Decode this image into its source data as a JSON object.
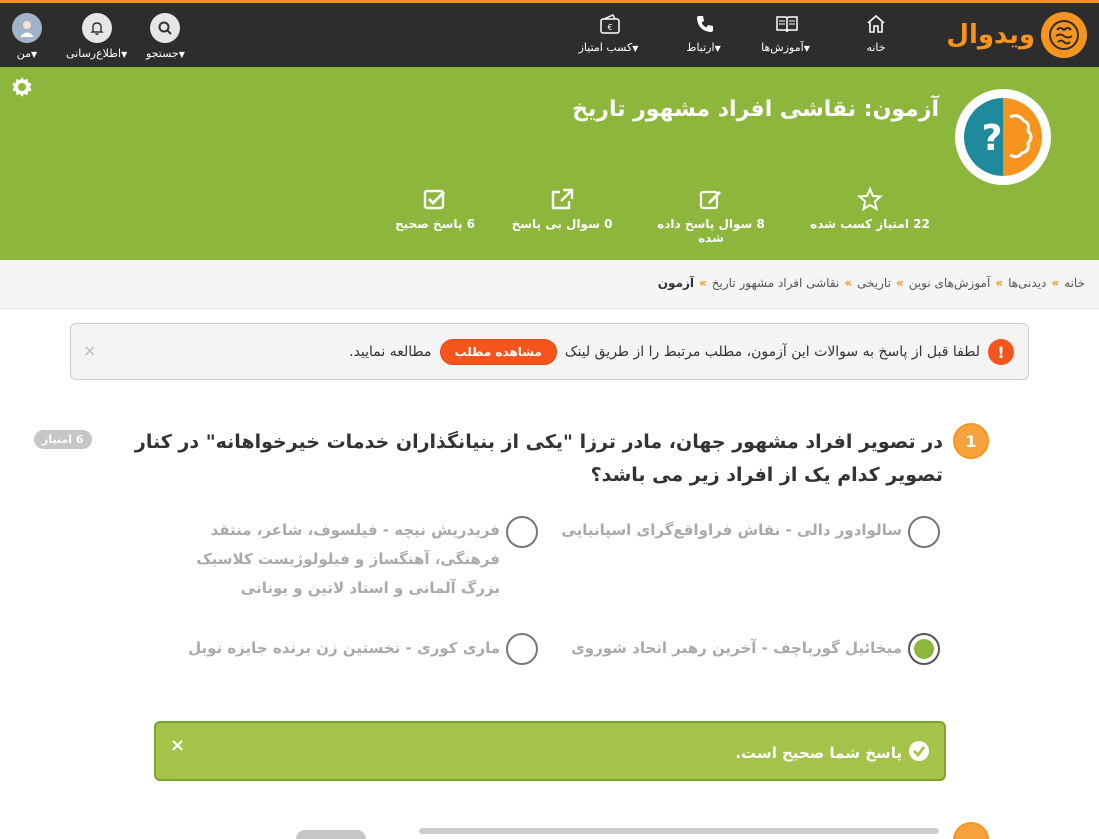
{
  "topnav": {
    "logo_text": "ویدوال",
    "items": [
      {
        "label": "خانه",
        "icon": "home-icon",
        "has_caret": false
      },
      {
        "label": "آموزش‌ها",
        "icon": "book-icon",
        "has_caret": true
      },
      {
        "label": "ارتباط",
        "icon": "phone-icon",
        "has_caret": true
      },
      {
        "label": "کسب امتیاز",
        "icon": "wallet-icon",
        "has_caret": true
      }
    ],
    "user_items": [
      {
        "label": "جستجو",
        "icon": "search-icon"
      },
      {
        "label": "اطلاع‌رسانی",
        "icon": "bell-icon"
      },
      {
        "label": "من",
        "icon": "avatar"
      }
    ]
  },
  "banner": {
    "title": "آزمون: نقاشی افراد مشهور تاریخ",
    "stats": [
      {
        "label": "22 امتیاز کسب شده",
        "icon": "star-icon"
      },
      {
        "label": "8 سوال پاسخ داده شده",
        "icon": "edit-icon"
      },
      {
        "label": "0 سوال بی پاسخ",
        "icon": "external-link-icon"
      },
      {
        "label": "6 پاسخ صحیح",
        "icon": "checkbox-icon"
      }
    ]
  },
  "breadcrumb": {
    "items": [
      "خانه",
      "دیدنی‌ها",
      "آموزش‌های نوین",
      "تاریخی",
      "نقاشی افراد مشهور تاریخ"
    ],
    "current": "آزمون",
    "separator": "»"
  },
  "notice": {
    "text_before": "لطفا قبل از پاسخ به سوالات این آزمون، مطلب مرتبط را از طریق لینک",
    "button": "مشاهده مطلب",
    "text_after": "مطالعه نمایید.",
    "close": "×"
  },
  "question": {
    "number": "1",
    "text": "در تصویر افراد مشهور جهان، مادر ترزا \"یکی از بنیانگذاران خدمات خیرخواهانه\" در کنار تصویر کدام یک از افراد زیر می باشد؟",
    "points": "6 امتیاز",
    "options": [
      {
        "text": "سالوادور دالی - نقاش فراواقع‌گرای اسپانیایی",
        "selected": false
      },
      {
        "text": "فریدریش نیچه - فیلسوف، شاعر، منتقد فرهنگی، آهنگساز و فیلولوژیست کلاسیک بزرگ آلمانی و استاد لاتین و یونانی",
        "selected": false
      },
      {
        "text": "میخائیل گورباچف - آخرین رهبر اتحاد شوروی",
        "selected": true
      },
      {
        "text": "ماری کوری - نخستین زن برنده جایزه نوبل",
        "selected": false
      }
    ]
  },
  "result": {
    "text": "پاسخ شما صحیح است.",
    "close": "×"
  },
  "colors": {
    "accent": "#f7941d",
    "green": "#8cb63c",
    "nav_bg": "#2d2d2d",
    "danger": "#f7541d"
  }
}
